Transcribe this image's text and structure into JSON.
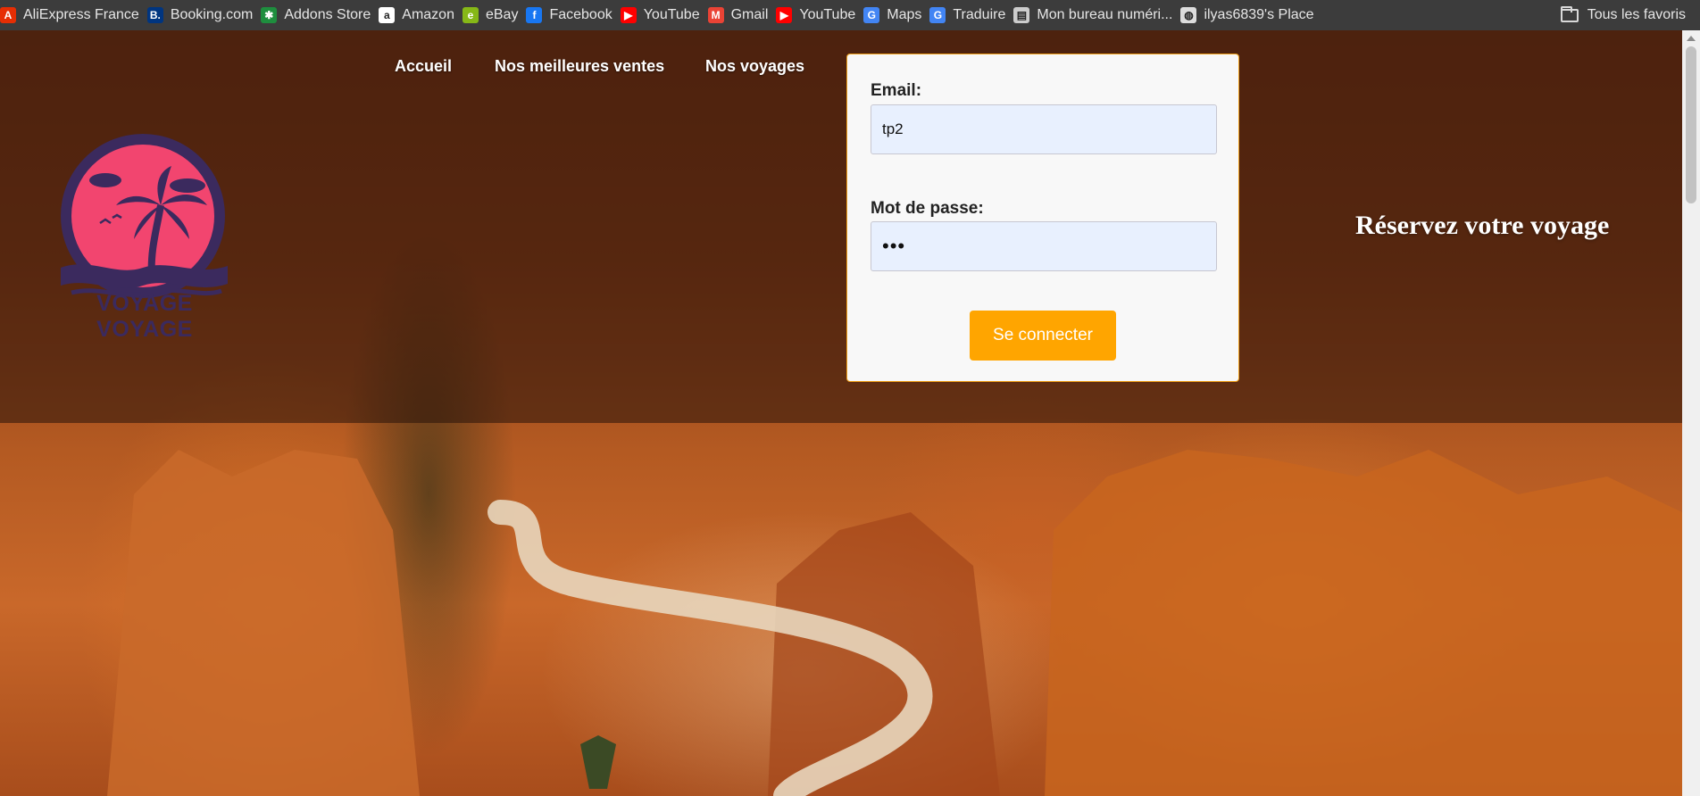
{
  "bookmarks": {
    "items": [
      {
        "label": "AliExpress France",
        "icon": "aliexpress-icon",
        "color": "#e62e04"
      },
      {
        "label": "Booking.com",
        "icon": "booking-icon",
        "color": "#003580"
      },
      {
        "label": "Addons Store",
        "icon": "addons-store-icon",
        "color": "#1e8e3e"
      },
      {
        "label": "Amazon",
        "icon": "amazon-icon",
        "color": "#ffffff"
      },
      {
        "label": "eBay",
        "icon": "ebay-icon",
        "color": "#86b817"
      },
      {
        "label": "Facebook",
        "icon": "facebook-icon",
        "color": "#1877f2"
      },
      {
        "label": "YouTube",
        "icon": "youtube-icon",
        "color": "#ff0000"
      },
      {
        "label": "Gmail",
        "icon": "gmail-icon",
        "color": "#ea4335"
      },
      {
        "label": "YouTube",
        "icon": "youtube-icon",
        "color": "#ff0000"
      },
      {
        "label": "Maps",
        "icon": "google-icon",
        "color": "#4285f4"
      },
      {
        "label": "Traduire",
        "icon": "translate-icon",
        "color": "#4285f4"
      },
      {
        "label": "Mon bureau numéri...",
        "icon": "document-icon",
        "color": "#cccccc"
      },
      {
        "label": "ilyas6839's Place",
        "icon": "globe-icon",
        "color": "#dddddd"
      }
    ],
    "all_favorites": "Tous les favoris"
  },
  "nav": {
    "home": "Accueil",
    "best_sellers": "Nos meilleures ventes",
    "trips": "Nos voyages"
  },
  "logo": {
    "text": "VOYAGE VOYAGE",
    "sun_color": "#f2456f",
    "ink_color": "#3b2a5e"
  },
  "login": {
    "email_label": "Email:",
    "email_value": "tp2",
    "password_label": "Mot de passe:",
    "password_value": "•••",
    "submit_label": "Se connecter",
    "accent_color": "#ffa500"
  },
  "tagline": "Réservez votre voyage"
}
